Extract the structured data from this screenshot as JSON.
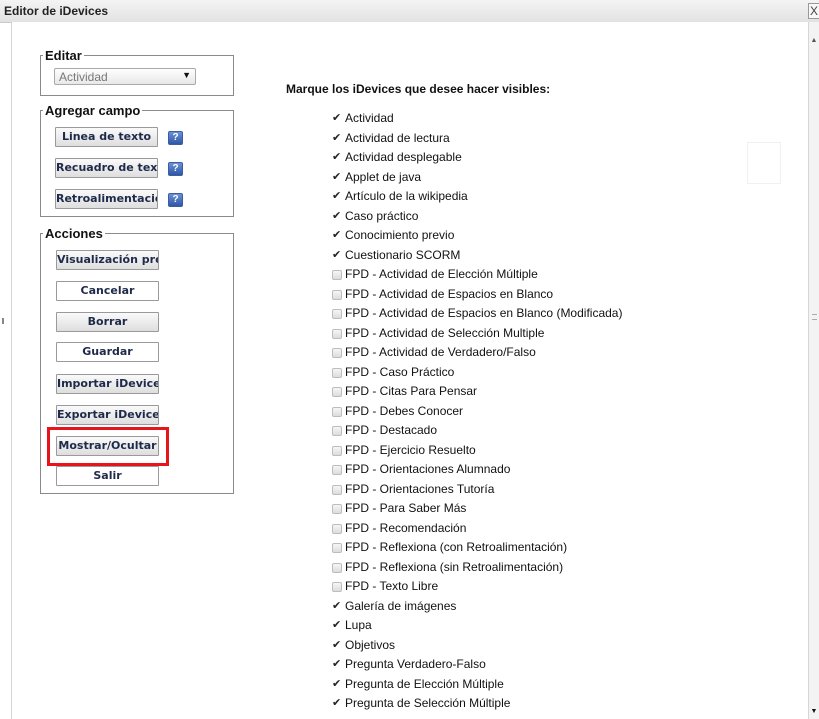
{
  "window": {
    "title": "Editor de iDevices",
    "close_label": "X"
  },
  "editar": {
    "legend": "Editar",
    "select_value": "Actividad"
  },
  "agregar": {
    "legend": "Agregar campo",
    "buttons": [
      "Linea de texto",
      "Recuadro de texto",
      "Retroalimentación"
    ],
    "help_label": "?"
  },
  "acciones": {
    "legend": "Acciones",
    "buttons": [
      "Visualización previa",
      "Cancelar",
      "Borrar",
      "Guardar",
      "Importar iDevices",
      "Exportar iDevices",
      "Mostrar/Ocultar",
      "Salir"
    ]
  },
  "main": {
    "heading": "Marque los iDevices que desee hacer visibles:",
    "idevices": [
      {
        "label": "Actividad",
        "checked": true
      },
      {
        "label": "Actividad de lectura",
        "checked": true
      },
      {
        "label": "Actividad desplegable",
        "checked": true
      },
      {
        "label": "Applet de java",
        "checked": true
      },
      {
        "label": "Artículo de la wikipedia",
        "checked": true
      },
      {
        "label": "Caso práctico",
        "checked": true
      },
      {
        "label": "Conocimiento previo",
        "checked": true
      },
      {
        "label": "Cuestionario SCORM",
        "checked": true
      },
      {
        "label": "FPD - Actividad de Elección Múltiple",
        "checked": false
      },
      {
        "label": "FPD - Actividad de Espacios en Blanco",
        "checked": false
      },
      {
        "label": "FPD - Actividad de Espacios en Blanco (Modificada)",
        "checked": false
      },
      {
        "label": "FPD - Actividad de Selección Multiple",
        "checked": false
      },
      {
        "label": "FPD - Actividad de Verdadero/Falso",
        "checked": false
      },
      {
        "label": "FPD - Caso Práctico",
        "checked": false
      },
      {
        "label": "FPD - Citas Para Pensar",
        "checked": false
      },
      {
        "label": "FPD - Debes Conocer",
        "checked": false
      },
      {
        "label": "FPD - Destacado",
        "checked": false
      },
      {
        "label": "FPD - Ejercicio Resuelto",
        "checked": false
      },
      {
        "label": "FPD - Orientaciones Alumnado",
        "checked": false
      },
      {
        "label": "FPD - Orientaciones Tutoría",
        "checked": false
      },
      {
        "label": "FPD - Para Saber Más",
        "checked": false
      },
      {
        "label": "FPD - Recomendación",
        "checked": false
      },
      {
        "label": "FPD - Reflexiona (con Retroalimentación)",
        "checked": false
      },
      {
        "label": "FPD - Reflexiona (sin Retroalimentación)",
        "checked": false
      },
      {
        "label": "FPD - Texto Libre",
        "checked": false
      },
      {
        "label": "Galería de imágenes",
        "checked": true
      },
      {
        "label": "Lupa",
        "checked": true
      },
      {
        "label": "Objetivos",
        "checked": true
      },
      {
        "label": "Pregunta Verdadero-Falso",
        "checked": true
      },
      {
        "label": "Pregunta de Elección Múltiple",
        "checked": true
      },
      {
        "label": "Pregunta de Selección Múltiple",
        "checked": true
      }
    ]
  }
}
